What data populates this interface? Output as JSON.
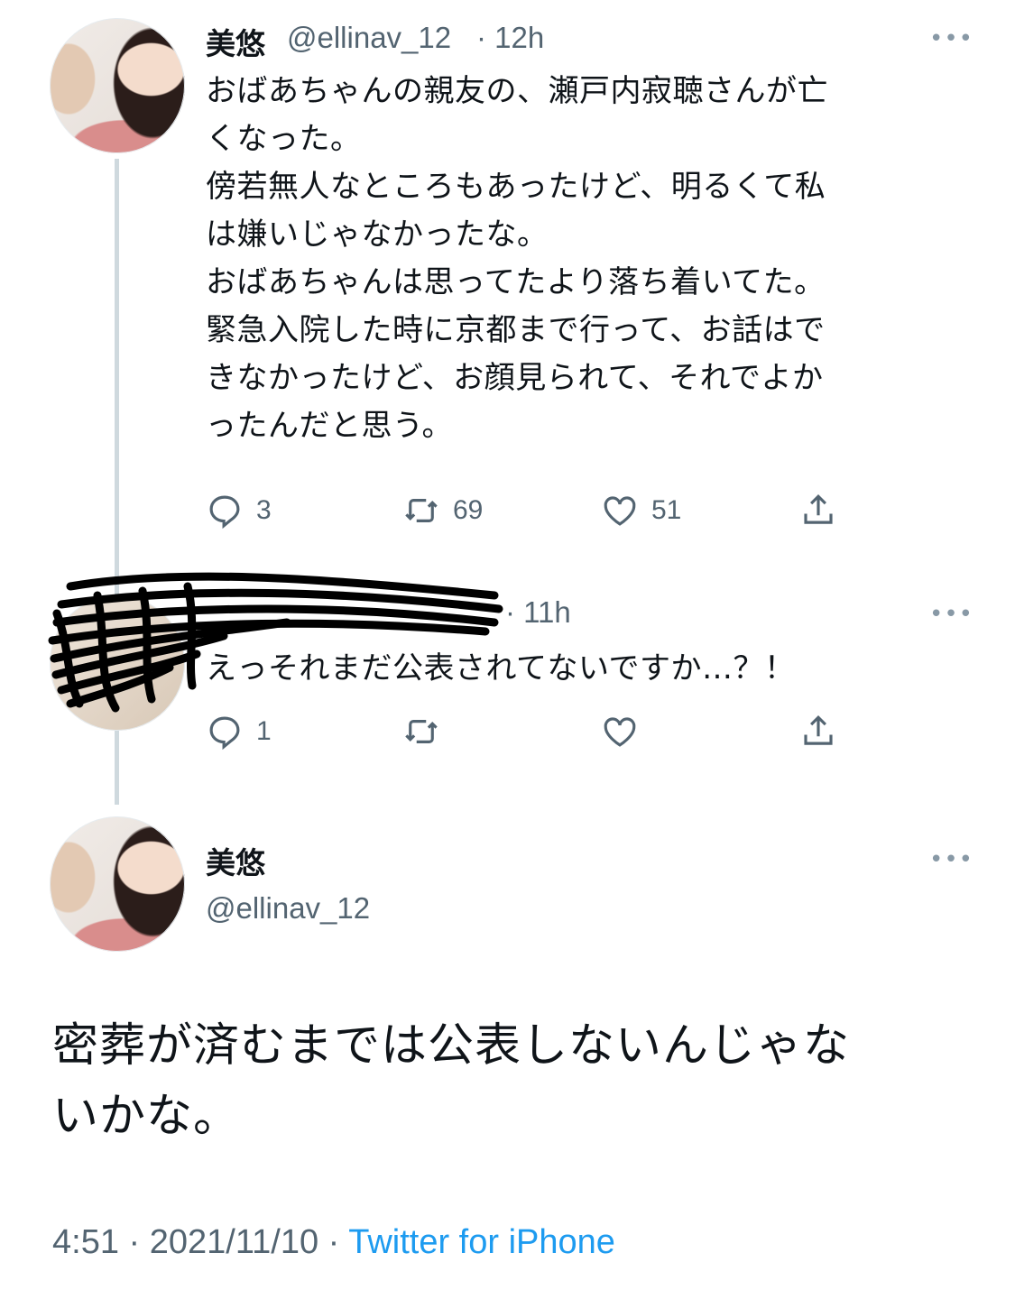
{
  "tweet1": {
    "name": "美悠",
    "handle": "@ellinav_12",
    "time": "· 12h",
    "text": "おばあちゃんの親友の、瀬戸内寂聴さんが亡\nくなった。\n傍若無人なところもあったけど、明るくて私\nは嫌いじゃなかったな。\nおばあちゃんは思ってたより落ち着いてた。\n緊急入院した時に京都まで行って、お話はで\nきなかったけど、お顔見られて、それでよか\nったんだと思う。",
    "reply_count": "3",
    "retweet_count": "69",
    "like_count": "51"
  },
  "tweet2": {
    "time": "· 11h",
    "text": "えっそれまだ公表されてないですか…？！",
    "reply_count": "1"
  },
  "tweet3": {
    "name": "美悠",
    "handle": "@ellinav_12",
    "text": "密葬が済むまでは公表しないんじゃな\nいかな。",
    "time": "4:51",
    "date": "· 2021/11/10 ·",
    "source": "Twitter for iPhone"
  },
  "icons": [
    "avatar",
    "more-icon",
    "reply-icon",
    "retweet-icon",
    "like-icon",
    "share-icon"
  ],
  "colors": {
    "text": "#0f1419",
    "secondary": "#536471",
    "link": "#1d9bf0",
    "thread_line": "#cfd9de"
  }
}
